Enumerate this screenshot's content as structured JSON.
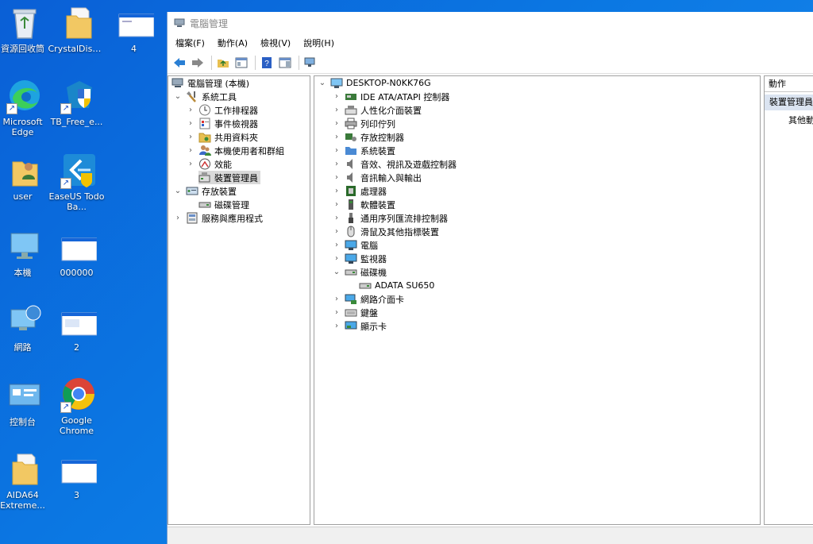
{
  "desktop": {
    "icons": [
      {
        "label": "資源回收筒"
      },
      {
        "label": "CrystalDisk..."
      },
      {
        "label": "4"
      },
      {
        "label": "Microsoft Edge"
      },
      {
        "label": "TB_Free_e..."
      },
      {
        "label": "user"
      },
      {
        "label": "EaseUS Todo Ba..."
      },
      {
        "label": "本機"
      },
      {
        "label": "000000"
      },
      {
        "label": "網路"
      },
      {
        "label": "2"
      },
      {
        "label": "控制台"
      },
      {
        "label": "Google Chrome"
      },
      {
        "label": "AIDA64 Extreme..."
      },
      {
        "label": "3"
      }
    ]
  },
  "window": {
    "title": "電腦管理",
    "menu": [
      "檔案(F)",
      "動作(A)",
      "檢視(V)",
      "說明(H)"
    ]
  },
  "left_tree": [
    {
      "label": "電腦管理 (本機)",
      "icon": "computer-management-icon"
    },
    {
      "label": "系統工具",
      "icon": "tools-icon"
    },
    {
      "label": "工作排程器",
      "icon": "clock-icon"
    },
    {
      "label": "事件檢視器",
      "icon": "event-viewer-icon"
    },
    {
      "label": "共用資料夾",
      "icon": "shared-folder-icon"
    },
    {
      "label": "本機使用者和群組",
      "icon": "users-icon"
    },
    {
      "label": "效能",
      "icon": "performance-icon"
    },
    {
      "label": "裝置管理員",
      "icon": "device-manager-icon"
    },
    {
      "label": "存放裝置",
      "icon": "storage-icon"
    },
    {
      "label": "磁碟管理",
      "icon": "disk-icon"
    },
    {
      "label": "服務與應用程式",
      "icon": "services-icon"
    }
  ],
  "device_tree": {
    "root": "DESKTOP-N0KK76G",
    "items": [
      {
        "label": "IDE ATA/ATAPI 控制器"
      },
      {
        "label": "人性化介面裝置"
      },
      {
        "label": "列印佇列"
      },
      {
        "label": "存放控制器"
      },
      {
        "label": "系統裝置"
      },
      {
        "label": "音效、視訊及遊戲控制器"
      },
      {
        "label": "音訊輸入與輸出"
      },
      {
        "label": "處理器"
      },
      {
        "label": "軟體裝置"
      },
      {
        "label": "通用序列匯流排控制器"
      },
      {
        "label": "滑鼠及其他指標裝置"
      },
      {
        "label": "電腦"
      },
      {
        "label": "監視器"
      },
      {
        "label": "磁碟機"
      },
      {
        "label": "ADATA SU650"
      },
      {
        "label": "網路介面卡"
      },
      {
        "label": "鍵盤"
      },
      {
        "label": "顯示卡"
      }
    ]
  },
  "actions": {
    "header": "動作",
    "section": "裝置管理員",
    "item": "其他動"
  }
}
